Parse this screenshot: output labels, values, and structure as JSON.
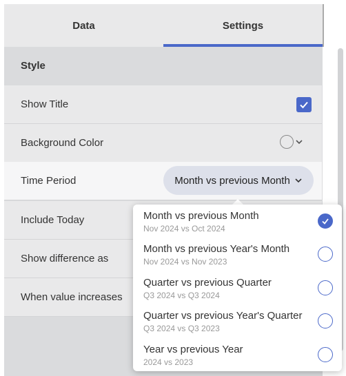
{
  "tabs": [
    {
      "label": "Data",
      "active": false
    },
    {
      "label": "Settings",
      "active": true
    }
  ],
  "section": {
    "title": "Style"
  },
  "rows": {
    "show_title": {
      "label": "Show Title",
      "checked": true
    },
    "background_color": {
      "label": "Background Color"
    },
    "time_period": {
      "label": "Time Period",
      "value": "Month vs previous Month"
    },
    "include_today": {
      "label": "Include Today"
    },
    "show_difference": {
      "label": "Show difference as"
    },
    "value_increases": {
      "label": "When value increases"
    }
  },
  "dropdown": {
    "options": [
      {
        "label": "Month vs previous Month",
        "sub": "Nov 2024 vs Oct 2024",
        "selected": true
      },
      {
        "label": "Month vs previous Year's Month",
        "sub": "Nov 2024 vs Nov 2023",
        "selected": false
      },
      {
        "label": "Quarter vs previous Quarter",
        "sub": "Q3 2024 vs Q3 2024",
        "selected": false
      },
      {
        "label": "Quarter vs previous Year's Quarter",
        "sub": "Q3 2024 vs Q3 2023",
        "selected": false
      },
      {
        "label": "Year vs previous Year",
        "sub": "2024 vs 2023",
        "selected": false
      }
    ]
  },
  "colors": {
    "accent": "#4a68c9",
    "panel": "#e9e9ea",
    "backdrop": "#dadbdd"
  },
  "icons": {
    "check": "check-icon",
    "chevron": "chevron-down-icon",
    "color": "color-swatch-icon"
  }
}
